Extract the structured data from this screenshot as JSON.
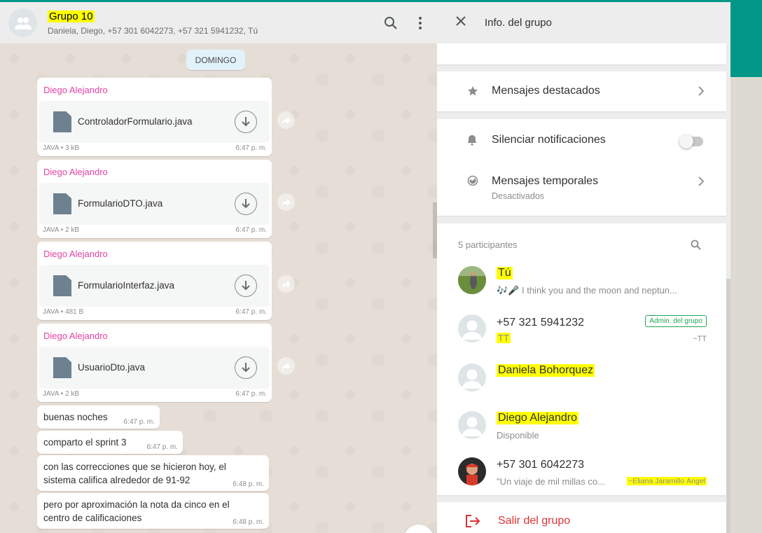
{
  "chat": {
    "title": "Grupo 10",
    "members": "Daniela, Diego, +57 301 6042273, +57 321 5941232, Tú",
    "day_chip": "DOMINGO",
    "file_messages": [
      {
        "sender": "Diego Alejandro",
        "file": "ControladorFormulario.java",
        "type": "JAVA",
        "size": "3 kB",
        "time": "6:47 p. m."
      },
      {
        "sender": "Diego Alejandro",
        "file": "FormularioDTO.java",
        "type": "JAVA",
        "size": "2 kB",
        "time": "6:47 p. m."
      },
      {
        "sender": "Diego Alejandro",
        "file": "FormularioInterfaz.java",
        "type": "JAVA",
        "size": "481 B",
        "time": "6:47 p. m."
      },
      {
        "sender": "Diego Alejandro",
        "file": "UsuarioDto.java",
        "type": "JAVA",
        "size": "2 kB",
        "time": "6:47 p. m."
      }
    ],
    "text_messages": [
      {
        "text": "buenas noches",
        "time": "6:47 p. m."
      },
      {
        "text": "comparto el sprint 3",
        "time": "6:47 p. m."
      },
      {
        "text": "con las correcciones que se hicieron hoy, el sistema califica alrededor de 91-92",
        "time": "6:48 p. m."
      },
      {
        "text": "pero por aproximación la nota da cinco en el centro de calificaciones",
        "time": "6:48 p. m."
      }
    ],
    "dot": "•"
  },
  "info": {
    "title": "Info. del grupo",
    "starred": "Mensajes destacados",
    "mute": "Silenciar notificaciones",
    "mute_on": false,
    "temporary": "Mensajes temporales",
    "temporary_status": "Desactivados",
    "participants_count": "5 participantes",
    "participants": [
      {
        "name": "Tú",
        "status": "🎶🎤 I think you and the moon and neptun..."
      },
      {
        "name": "+57 321 5941232",
        "status": "TT",
        "badge": "Admin. del grupo",
        "push": "~TT"
      },
      {
        "name": "Daniela Bohorquez",
        "status": ""
      },
      {
        "name": "Diego Alejandro",
        "status": "Disponible"
      },
      {
        "name": "+57 301 6042273",
        "status": "\"Un viaje de mil millas co...",
        "push": "~Eliana Jaramillo Ángel"
      }
    ],
    "exit": "Salir del grupo"
  },
  "colors": {
    "accent": "#009688",
    "sender": "#e542a3",
    "highlight": "#ffff00",
    "danger": "#df3333",
    "admin": "#1fa855"
  }
}
